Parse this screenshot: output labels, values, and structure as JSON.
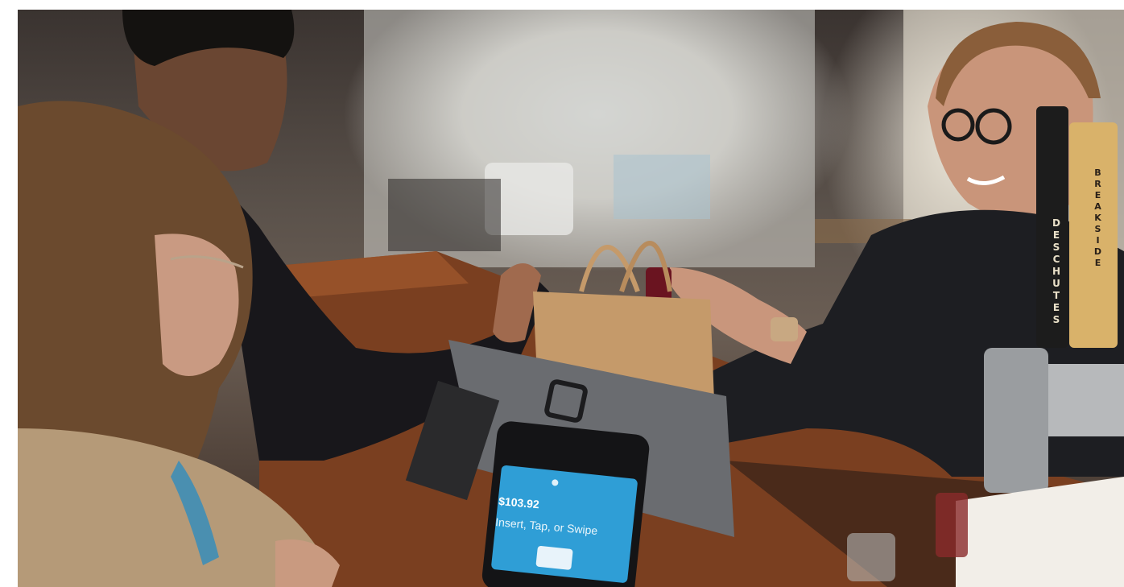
{
  "photo": {
    "alt": "",
    "card_reader": {
      "amount": "$103.92",
      "prompt": "Insert, Tap, or Swipe"
    },
    "beer_taps": {
      "tap_1_label": "DESCHUTES",
      "tap_2_label": "BREAKSIDE"
    },
    "colors": {
      "reader_screen": "#2f9ed6",
      "bag": "#c59a6a",
      "counter_wood": "#8a4a26",
      "clothing_dark": "#1d1e22"
    }
  }
}
